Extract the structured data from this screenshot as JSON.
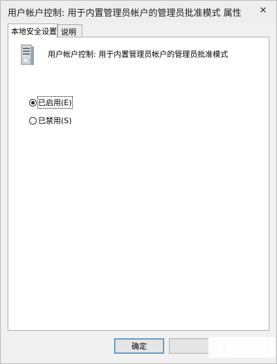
{
  "window": {
    "title": "用户帐户控制: 用于内置管理员帐户的管理员批准模式 属性",
    "close_glyph": "✕"
  },
  "tabs": [
    {
      "label": "本地安全设置",
      "active": true
    },
    {
      "label": "说明",
      "active": false
    }
  ],
  "policy": {
    "icon": "server-icon",
    "name": "用户帐户控制: 用于内置管理员帐户的管理员批准模式"
  },
  "options": [
    {
      "label": "已启用(E)",
      "selected": true
    },
    {
      "label": "已禁用(S)",
      "selected": false
    }
  ],
  "buttons": {
    "ok": "确定",
    "cancel": "",
    "apply": ""
  },
  "colors": {
    "window_bg": "#f0f0f0",
    "panel_bg": "#ffffff",
    "border": "#adadad",
    "default_button_border": "#3c7fb1"
  }
}
